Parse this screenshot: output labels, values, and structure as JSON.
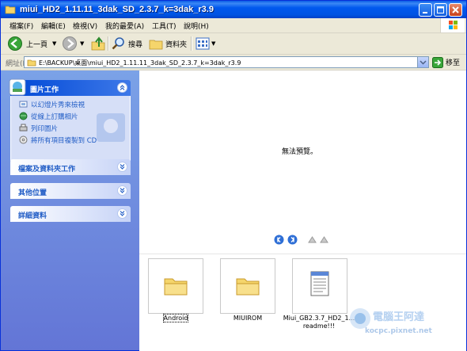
{
  "window": {
    "title": "miui_HD2_1.11.11_3dak_SD_2.3.7_k=3dak_r3.9"
  },
  "menu": [
    "檔案(F)",
    "編輯(E)",
    "檢視(V)",
    "我的最愛(A)",
    "工具(T)",
    "說明(H)"
  ],
  "toolbar": {
    "back_label": "上一頁",
    "search_label": "搜尋",
    "folders_label": "資料夾"
  },
  "address": {
    "label": "網址(D)",
    "value": "E:\\BACKUP\\桌面\\miui_HD2_1.11.11_3dak_SD_2.3.7_k=3dak_r3.9",
    "go_label": "移至"
  },
  "tasks": {
    "picture_tasks": {
      "title": "圖片工作",
      "links": [
        "以幻燈片秀來檢視",
        "從線上訂購相片",
        "列印圖片",
        "將所有項目複製到 CD"
      ]
    },
    "file_folder_tasks": "檔案及資料夾工作",
    "other_places": "其他位置",
    "details": "詳細資料"
  },
  "preview": {
    "message": "無法預覽。"
  },
  "files": [
    {
      "name": "Android",
      "type": "folder-icon",
      "selected": true
    },
    {
      "name": "MIUIROM",
      "type": "folder-icon",
      "selected": false
    },
    {
      "name": "Miui_GB2.3.7_HD2_1...",
      "name2": "readme!!!",
      "type": "notepad-icon",
      "selected": false
    }
  ],
  "watermark": {
    "line1": "電腦王阿達",
    "line2": "kocpc.pixnet.net"
  },
  "colors": {
    "titlebar": "#0054e3",
    "taskpane": "#6375d6",
    "link": "#215dc6"
  }
}
